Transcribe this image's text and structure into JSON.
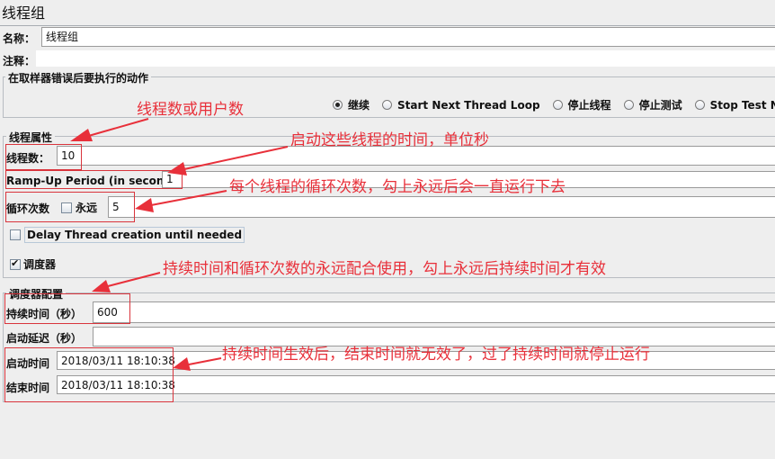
{
  "window": {
    "title": "线程组"
  },
  "form": {
    "name_label": "名称：",
    "name_value": "线程组",
    "comment_label": "注释：",
    "comment_value": ""
  },
  "error_action": {
    "legend": "在取样器错误后要执行的动作",
    "options": [
      {
        "label": "继续",
        "selected": true
      },
      {
        "label": "Start Next Thread Loop",
        "selected": false
      },
      {
        "label": "停止线程",
        "selected": false
      },
      {
        "label": "停止测试",
        "selected": false
      },
      {
        "label": "Stop Test Now",
        "selected": false
      }
    ]
  },
  "thread_props": {
    "legend": "线程属性",
    "threads_label": "线程数：",
    "threads_value": "10",
    "rampup_label": "Ramp-Up Period (in seconds):",
    "rampup_value": "1",
    "loop_label": "循环次数",
    "forever_label": "永远",
    "forever_checked": false,
    "loop_value": "5",
    "delay_label": "Delay Thread creation until needed",
    "delay_checked": false,
    "scheduler_label": "调度器",
    "scheduler_checked": true
  },
  "scheduler": {
    "legend": "调度器配置",
    "duration_label": "持续时间（秒）",
    "duration_value": "600",
    "startup_delay_label": "启动延迟（秒）",
    "startup_delay_value": "",
    "start_time_label": "启动时间",
    "start_time_value": "2018/03/11 18:10:38",
    "end_time_label": "结束时间",
    "end_time_value": "2018/03/11 18:10:38"
  },
  "annotations": {
    "threads_note": "线程数或用户数",
    "rampup_note": "启动这些线程的时间，单位秒",
    "loop_note": "每个线程的循环次数，勾上永远后会一直运行下去",
    "scheduler_note": "持续时间和循环次数的永远配合使用，勾上永远后持续时间才有效",
    "time_note": "持续时间生效后，结束时间就无效了，过了持续时间就停止运行",
    "color": "#e8303a"
  }
}
